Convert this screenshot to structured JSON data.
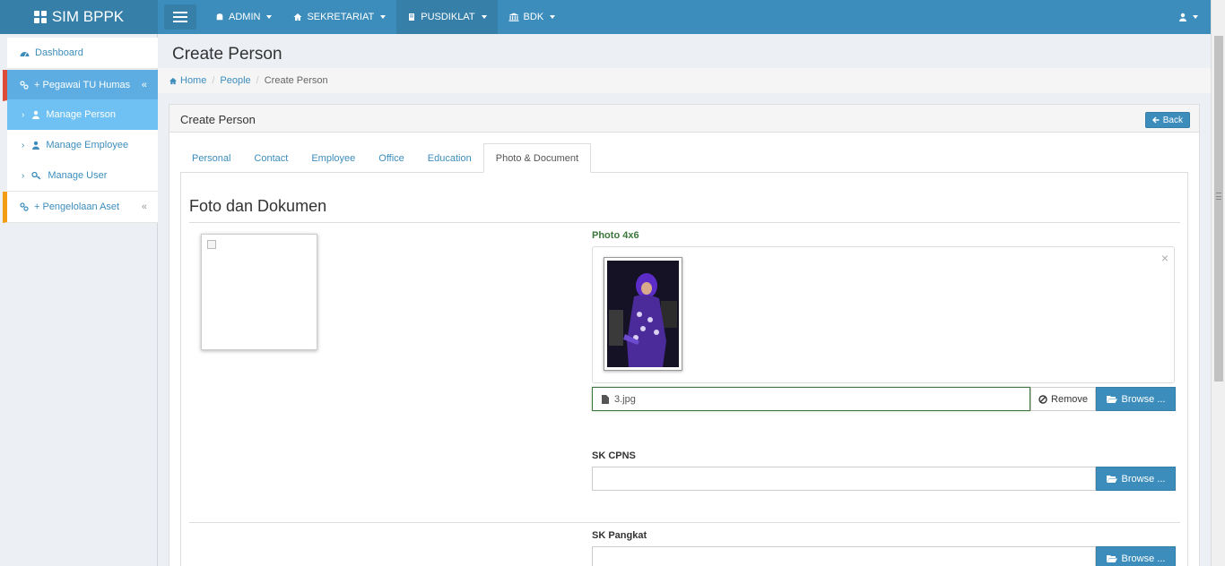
{
  "app": {
    "brand": "SIM BPPK"
  },
  "topnav": {
    "items": [
      {
        "label": "ADMIN",
        "icon": "android-icon"
      },
      {
        "label": "SEKRETARIAT",
        "icon": "home-icon"
      },
      {
        "label": "PUSDIKLAT",
        "icon": "book-icon",
        "active": true
      },
      {
        "label": "BDK",
        "icon": "bank-icon"
      }
    ],
    "user_icon": "user-icon"
  },
  "sidebar": {
    "dashboard": "Dashboard",
    "group1": "+ Pegawai TU Humas",
    "manage_person": "Manage Person",
    "manage_employee": "Manage Employee",
    "manage_user": "Manage User",
    "group2": "+ Pengelolaan Aset",
    "collapse_glyph": "«",
    "chevron_glyph": "›"
  },
  "page": {
    "title": "Create Person",
    "breadcrumb": {
      "home": "Home",
      "people": "People",
      "current": "Create Person",
      "sep": "/"
    }
  },
  "box": {
    "title": "Create Person",
    "back": "Back"
  },
  "tabs": [
    "Personal",
    "Contact",
    "Employee",
    "Office",
    "Education",
    "Photo & Document"
  ],
  "section": {
    "title": "Foto dan Dokumen",
    "photo_label": "Photo 4x6",
    "file_name": "3.jpg",
    "remove": "Remove",
    "browse": "Browse ...",
    "close": "×",
    "sk_cpns_label": "SK CPNS",
    "sk_pangkat_label": "SK Pangkat"
  },
  "colors": {
    "primary": "#3c8dbc",
    "primary_dark": "#367fa9",
    "sidebar_red": "#dd4b39",
    "sidebar_yellow": "#f39c12",
    "success": "#3c763d"
  }
}
